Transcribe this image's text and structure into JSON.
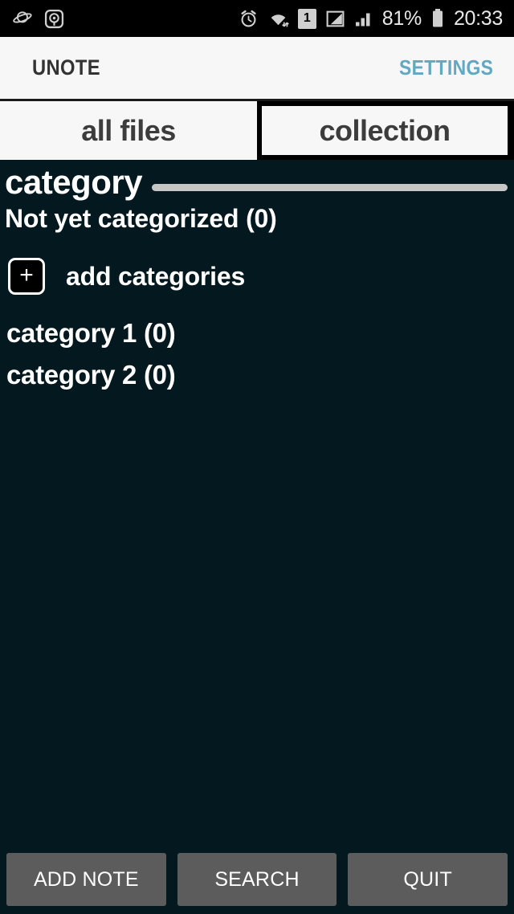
{
  "statusbar": {
    "left_icons": [
      {
        "name": "planet-icon",
        "glyph": "saturn"
      },
      {
        "name": "disc-app-icon",
        "glyph": "disc"
      }
    ],
    "right_icons": [
      {
        "name": "alarm-clock-icon"
      },
      {
        "name": "wifi-icon"
      },
      {
        "name": "sim-card-icon",
        "label": "1"
      },
      {
        "name": "signal-triangle-icon"
      },
      {
        "name": "signal-bars-icon"
      },
      {
        "name": "battery-icon"
      }
    ],
    "battery_percent": "81%",
    "clock": "20:33"
  },
  "appbar": {
    "title": "UNOTE",
    "settings_label": "SETTINGS",
    "settings_color": "#63a8c2"
  },
  "tabs": [
    {
      "label": "all files",
      "selected": false
    },
    {
      "label": "collection",
      "selected": true
    }
  ],
  "content": {
    "section_title": "category",
    "uncategorized_label": "Not yet categorized (0)",
    "add_categories_label": "add categories",
    "add_icon": "plus-icon",
    "categories": [
      {
        "label": "category 1 (0)"
      },
      {
        "label": "category 2 (0)"
      }
    ]
  },
  "bottombar": {
    "buttons": [
      {
        "label": "ADD NOTE",
        "name": "add-note-button"
      },
      {
        "label": "SEARCH",
        "name": "search-button"
      },
      {
        "label": "QUIT",
        "name": "quit-button"
      }
    ]
  },
  "colors": {
    "background": "#04191f",
    "appbar_bg": "#f7f7f7",
    "accent": "#63a8c2",
    "button_bg": "#5c5c5c",
    "rule": "#c6c6c6"
  }
}
